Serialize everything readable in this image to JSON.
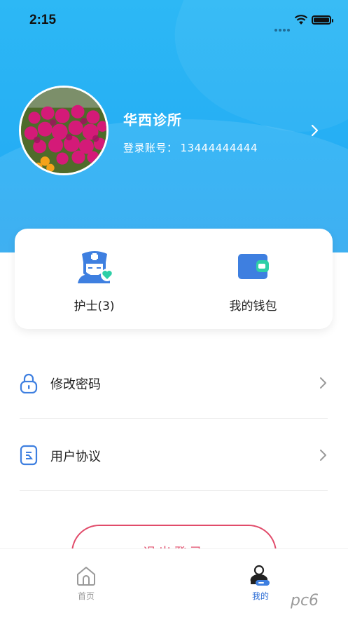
{
  "status_bar": {
    "time": "2:15"
  },
  "profile": {
    "name": "华西诊所",
    "account_label": "登录账号：",
    "account_value": "13444444444"
  },
  "quick_actions": [
    {
      "label": "护士(3)",
      "icon": "nurse-icon"
    },
    {
      "label": "我的钱包",
      "icon": "wallet-icon"
    }
  ],
  "menu": [
    {
      "label": "修改密码",
      "icon": "lock-icon"
    },
    {
      "label": "用户协议",
      "icon": "document-icon"
    }
  ],
  "logout_label": "退出登录",
  "tabbar": [
    {
      "label": "首页",
      "icon": "home-icon",
      "active": false
    },
    {
      "label": "我的",
      "icon": "user-icon",
      "active": true
    }
  ],
  "watermark": "pc6",
  "colors": {
    "accent": "#2aaef5",
    "header": "#2db8f5",
    "logout": "#e14b6a",
    "tab_active": "#2f6fd6",
    "tab_inactive": "#999999"
  }
}
